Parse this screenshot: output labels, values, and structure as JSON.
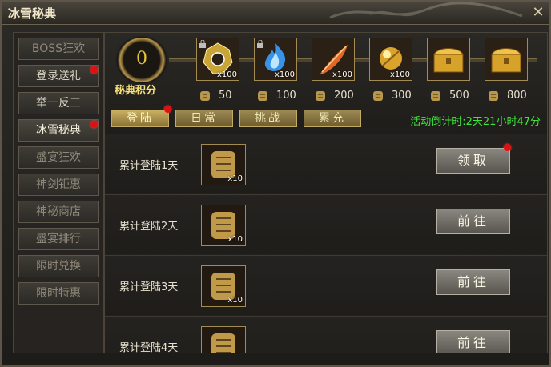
{
  "window": {
    "title": "冰雪秘典"
  },
  "sidebar": {
    "items": [
      {
        "label": "BOSS狂欢"
      },
      {
        "label": "登录送礼"
      },
      {
        "label": "举一反三"
      },
      {
        "label": "冰雪秘典"
      },
      {
        "label": "盛宴狂欢"
      },
      {
        "label": "神剑钜惠"
      },
      {
        "label": "神秘商店"
      },
      {
        "label": "盛宴排行"
      },
      {
        "label": "限时兑换"
      },
      {
        "label": "限时特惠"
      }
    ]
  },
  "score": {
    "value": "0",
    "label": "秘典积分"
  },
  "rewards": [
    {
      "count": "x100",
      "cost": "50",
      "icon": "emblem-icon",
      "locked": true
    },
    {
      "count": "x100",
      "cost": "100",
      "icon": "blue-flame-icon",
      "locked": true
    },
    {
      "count": "x100",
      "cost": "200",
      "icon": "feather-icon",
      "locked": false
    },
    {
      "count": "x100",
      "cost": "300",
      "icon": "gold-orb-icon",
      "locked": false
    },
    {
      "count": "",
      "cost": "500",
      "icon": "gold-chest-icon",
      "locked": false
    },
    {
      "count": "",
      "cost": "800",
      "icon": "gold-chest-icon",
      "locked": false
    }
  ],
  "tabs": [
    {
      "label": "登陆"
    },
    {
      "label": "日常"
    },
    {
      "label": "挑战"
    },
    {
      "label": "累充"
    }
  ],
  "countdown": "活动倒计时:2天21小时47分",
  "tasks": [
    {
      "label": "累计登陆1天",
      "item_count": "x10",
      "action": "领取"
    },
    {
      "label": "累计登陆2天",
      "item_count": "x10",
      "action": "前往"
    },
    {
      "label": "累计登陆3天",
      "item_count": "x10",
      "action": "前往"
    },
    {
      "label": "累计登陆4天",
      "item_count": "",
      "action": "前往"
    }
  ],
  "colors": {
    "accent_gold": "#e9c23b",
    "countdown_green": "#3ee43e",
    "notice_red": "#e01010"
  }
}
